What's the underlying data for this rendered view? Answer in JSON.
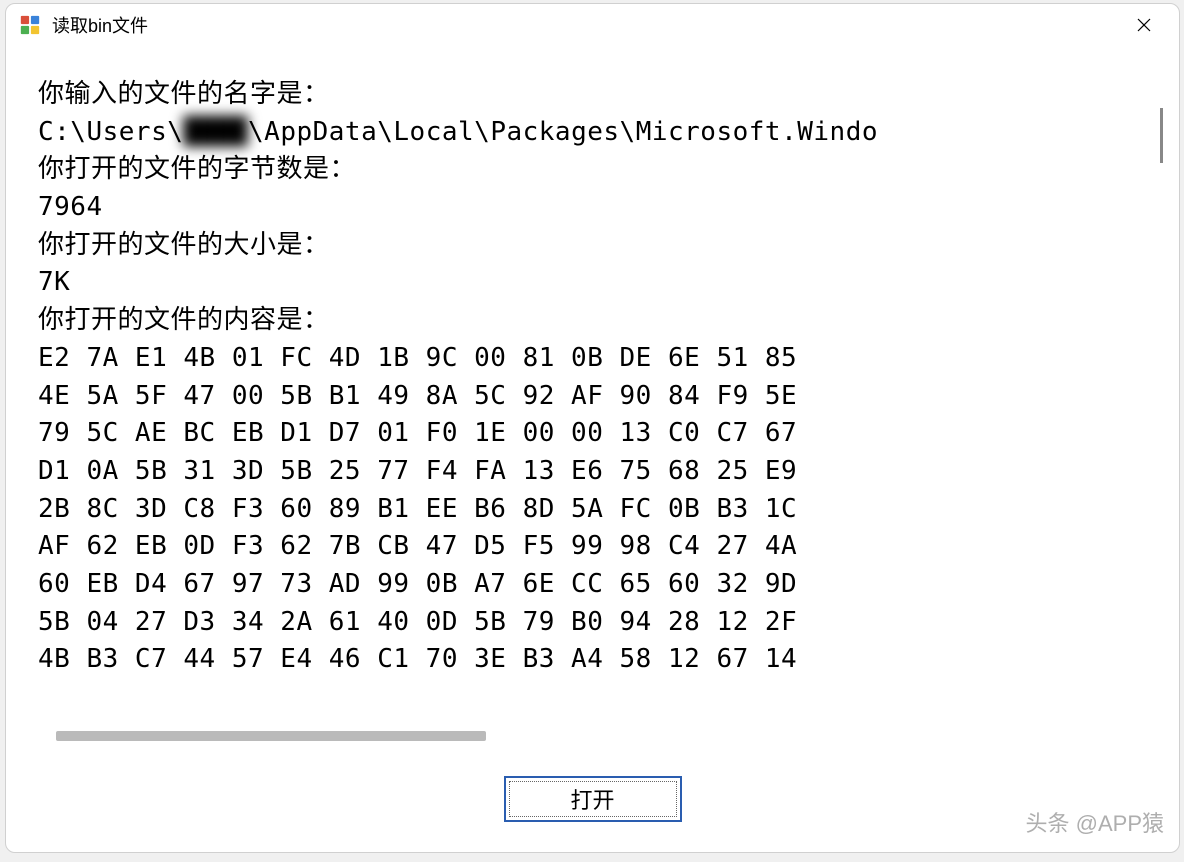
{
  "window": {
    "title": "读取bin文件"
  },
  "output": {
    "filename_label": "你输入的文件的名字是：",
    "filename_path_prefix": "C:\\Users\\",
    "filename_path_blurred": "████",
    "filename_path_suffix": "\\AppData\\Local\\Packages\\Microsoft.Windo",
    "bytecount_label": "你打开的文件的字节数是：",
    "bytecount_value": "7964",
    "filesize_label": "你打开的文件的大小是：",
    "filesize_value": "7K",
    "content_label": "你打开的文件的内容是：",
    "hex_rows": [
      "E2 7A E1 4B 01 FC 4D 1B 9C 00 81 0B DE 6E 51 85",
      "4E 5A 5F 47 00 5B B1 49 8A 5C 92 AF 90 84 F9 5E",
      "79 5C AE BC EB D1 D7 01 F0 1E 00 00 13 C0 C7 67",
      "D1 0A 5B 31 3D 5B 25 77 F4 FA 13 E6 75 68 25 E9",
      "2B 8C 3D C8 F3 60 89 B1 EE B6 8D 5A FC 0B B3 1C",
      "AF 62 EB 0D F3 62 7B CB 47 D5 F5 99 98 C4 27 4A",
      "60 EB D4 67 97 73 AD 99 0B A7 6E CC 65 60 32 9D",
      "5B 04 27 D3 34 2A 61 40 0D 5B 79 B0 94 28 12 2F",
      "4B B3 C7 44 57 E4 46 C1 70 3E B3 A4 58 12 67 14"
    ]
  },
  "buttons": {
    "open_label": "打开"
  },
  "watermark": "头条 @APP猿"
}
